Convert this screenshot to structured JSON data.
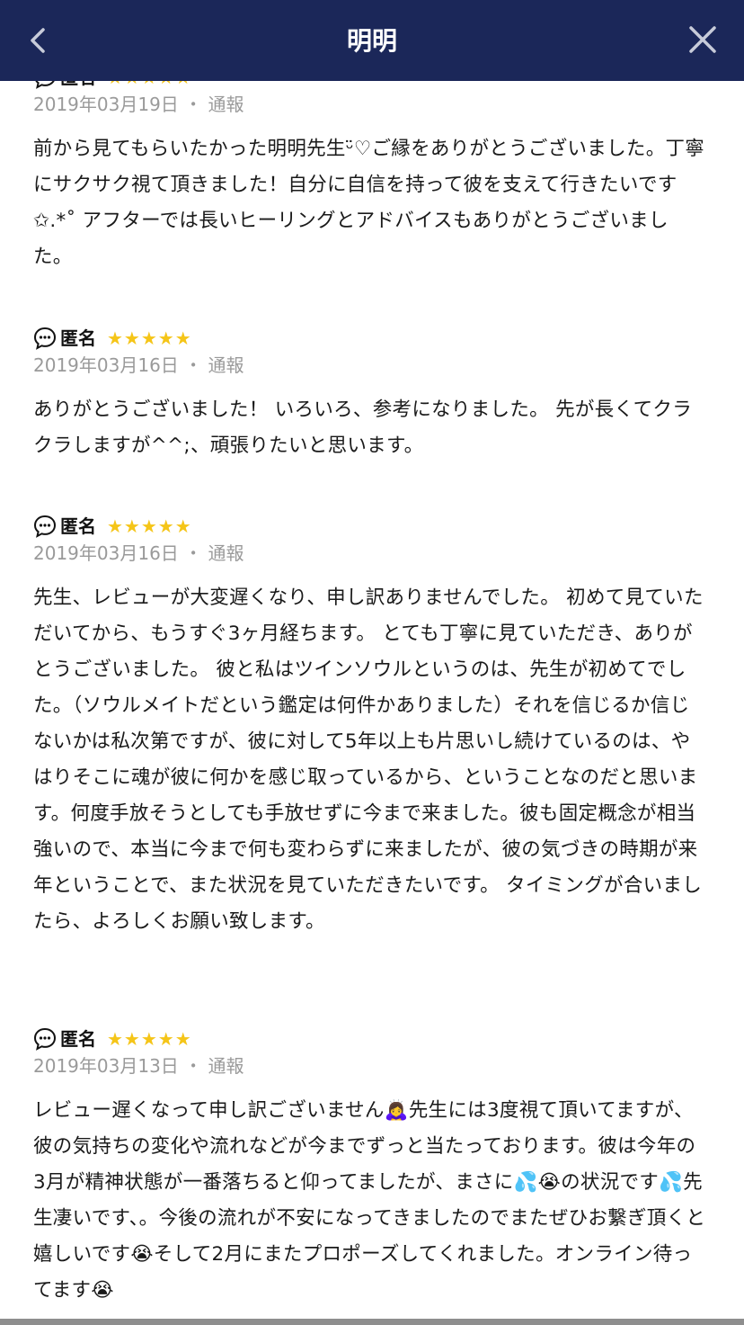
{
  "header": {
    "title": "明明",
    "back_icon": "chevron-left-icon",
    "close_icon": "close-icon",
    "background": "#1b2759"
  },
  "reviews": [
    {
      "author": "匿名",
      "stars": "★★★★★",
      "date": "2019年03月19日",
      "separator": "・",
      "report": "通報",
      "text": "前から見てもらいたかった明明先生ᵕ̈♡ご縁をありがとうございました。丁寧にサクサク視て頂きました！自分に自信を持って彼を支えて行きたいです✩.*˚ アフターでは長いヒーリングとアドバイスもありがとうございました。"
    },
    {
      "author": "匿名",
      "stars": "★★★★★",
      "date": "2019年03月16日",
      "separator": "・",
      "report": "通報",
      "text": "ありがとうございました！ いろいろ、参考になりました。 先が長くてクラクラしますが^^;、頑張りたいと思います。"
    },
    {
      "author": "匿名",
      "stars": "★★★★★",
      "date": "2019年03月16日",
      "separator": "・",
      "report": "通報",
      "text": "先生、レビューが大変遅くなり、申し訳ありませんでした。 初めて見ていただいてから、もうすぐ3ヶ月経ちます。 とても丁寧に見ていただき、ありがとうございました。 彼と私はツインソウルというのは、先生が初めてでした。（ソウルメイトだという鑑定は何件かありました）それを信じるか信じないかは私次第ですが、彼に対して5年以上も片思いし続けているのは、やはりそこに魂が彼に何かを感じ取っているから、ということなのだと思います。何度手放そうとしても手放せずに今まで来ました。彼も固定概念が相当強いので、本当に今まで何も変わらずに来ましたが、彼の気づきの時期が来年ということで、また状況を見ていただきたいです。 タイミングが合いましたら、よろしくお願い致します。"
    },
    {
      "author": "匿名",
      "stars": "★★★★★",
      "date": "2019年03月13日",
      "separator": "・",
      "report": "通報",
      "text": "レビュー遅くなって申し訳ございません🙇‍♀️先生には3度視て頂いてますが、彼の気持ちの変化や流れなどが今までずっと当たっております。彼は今年の3月が精神状態が一番落ちると仰ってましたが、まさに💦😭の状況です💦先生凄いです、。今後の流れが不安になってきましたのでまたぜひお繋ぎ頂くと嬉しいです😭そして2月にまたプロポーズしてくれました。オンライン待ってます😭"
    }
  ],
  "icons": {
    "comment": "speech-bubble-icon",
    "rating": "star-icon"
  },
  "colors": {
    "star": "#f5c518",
    "meta": "#9a9a9a"
  }
}
